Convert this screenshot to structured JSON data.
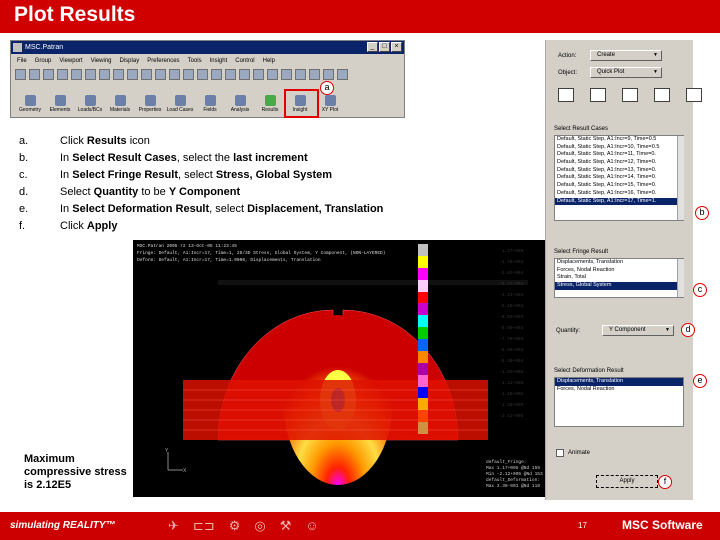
{
  "slide": {
    "title": "Plot Results",
    "page_number": "17"
  },
  "patran_window": {
    "title": "MSC.Patran",
    "menu": [
      "File",
      "Group",
      "Viewport",
      "Viewing",
      "Display",
      "Preferences",
      "Tools",
      "Insight",
      "Control",
      "Help"
    ],
    "apps": [
      "Geometry",
      "Elements",
      "Loads/BCs",
      "Materials",
      "Properties",
      "Load Cases",
      "Fields",
      "Analysis",
      "Results",
      "Insight",
      "XY Plot"
    ],
    "highlighted_app": "Results"
  },
  "callouts": [
    "a",
    "b",
    "c",
    "d",
    "e",
    "f"
  ],
  "steps": [
    {
      "letter": "a.",
      "parts": [
        [
          "Click ",
          false
        ],
        [
          "Results",
          true
        ],
        [
          " icon",
          false
        ]
      ]
    },
    {
      "letter": "b.",
      "parts": [
        [
          "In ",
          false
        ],
        [
          "Select Result Cases",
          true
        ],
        [
          ", select the ",
          false
        ],
        [
          "last increment",
          true
        ]
      ]
    },
    {
      "letter": "c.",
      "parts": [
        [
          "In ",
          false
        ],
        [
          "Select Fringe Result",
          true
        ],
        [
          ", select ",
          false
        ],
        [
          "Stress, Global System",
          true
        ]
      ]
    },
    {
      "letter": "d.",
      "parts": [
        [
          "Select ",
          false
        ],
        [
          "Quantity",
          true
        ],
        [
          " to be ",
          false
        ],
        [
          "Y Component",
          true
        ]
      ]
    },
    {
      "letter": "e.",
      "parts": [
        [
          "In ",
          false
        ],
        [
          "Select Deformation Result",
          true
        ],
        [
          ", select ",
          false
        ],
        [
          "Displacement, Translation",
          true
        ]
      ]
    },
    {
      "letter": "f.",
      "parts": [
        [
          "Click ",
          false
        ],
        [
          "Apply",
          true
        ]
      ]
    }
  ],
  "note": "Maximum compressive stress is 2.12E5",
  "plot": {
    "header": [
      "MSC.Patran 2005 r2 13-Oct-05 11:23:45",
      "Fringe: Default, A1:Incr=17, Time=1, 2D/3D Stress, Global System, Y Component, (NON-LAYERED)",
      "Deform: Default, A1:Incr=17, Time=1.0000, Displacements, Translation"
    ],
    "legend_values": [
      "-1.17+005",
      "-1.78+004",
      "-2.62+004",
      "-3.47+004",
      "-4.31+004",
      "-5.16+004",
      "-6.01+004",
      "-6.85+004",
      "-7.70+004",
      "-8.55+004",
      "-9.39+004",
      "-1.02+005",
      "-1.11+005",
      "-1.19+005",
      "-1.28+005",
      "-2.12+005"
    ],
    "legend_colors": [
      "#c0c0c0",
      "#ffff00",
      "#ff00ff",
      "#ffccff",
      "#ff0000",
      "#cc00cc",
      "#00ffff",
      "#00cc00",
      "#0066ff",
      "#ff8800",
      "#aa00aa",
      "#ff66cc",
      "#0000ff",
      "#ffaa00",
      "#ff4400",
      "#d09040"
    ],
    "footer_lines": [
      "default_Fringe:",
      "Max 1.17+005 @Nd 159",
      "Min -2.12+005 @Nd 153",
      "default_Deformation:",
      "Max 3.30-001 @Nd 119"
    ]
  },
  "panel": {
    "action_label": "Action:",
    "action_value": "Create",
    "object_label": "Object:",
    "object_value": "Quick Plot",
    "result_cases_label": "Select Result Cases",
    "result_cases": [
      "Default, Static Step, A1:Incr=9, Time=0.5",
      "Default, Static Step, A1:Incr=10, Time=0.5",
      "Default, Static Step, A1:Incr=11, Time=0.",
      "Default, Static Step, A1:Incr=12, Time=0.",
      "Default, Static Step, A1:Incr=13, Time=0.",
      "Default, Static Step, A1:Incr=14, Time=0.",
      "Default, Static Step, A1:Incr=15, Time=0.",
      "Default, Static Step, A1:Incr=16, Time=0.",
      "Default, Static Step, A1:Incr=17, Time=1."
    ],
    "result_cases_selected": 8,
    "fringe_label": "Select Fringe Result",
    "fringe_items": [
      "Displacements, Translation",
      "Forces, Nodal Reaction",
      "Strain, Total",
      "Stress, Global System"
    ],
    "fringe_selected": 3,
    "quantity_label": "Quantity:",
    "quantity_value": "Y Component",
    "deformation_label": "Select Deformation Result",
    "deformation_items": [
      "Displacements, Translation",
      "Forces, Nodal Reaction"
    ],
    "deformation_selected": 0,
    "animate_label": "Animate",
    "apply_label": "Apply"
  },
  "footer": {
    "brand": "simulating REALITY™",
    "logo": "MSC Software"
  }
}
